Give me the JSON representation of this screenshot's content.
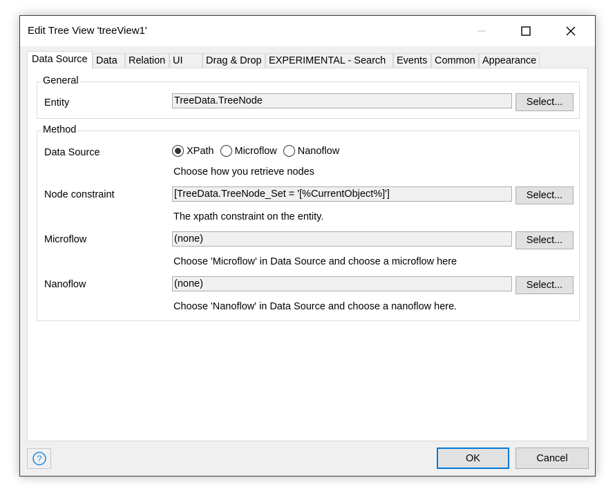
{
  "window": {
    "title": "Edit Tree View 'treeView1'"
  },
  "tabs": [
    {
      "label": "Data Source",
      "active": true
    },
    {
      "label": "Data",
      "active": false
    },
    {
      "label": "Relation",
      "active": false
    },
    {
      "label": "UI",
      "active": false
    },
    {
      "label": "Drag & Drop",
      "active": false
    },
    {
      "label": "EXPERIMENTAL - Search",
      "active": false
    },
    {
      "label": "Events",
      "active": false
    },
    {
      "label": "Common",
      "active": false
    },
    {
      "label": "Appearance",
      "active": false
    }
  ],
  "general": {
    "title": "General",
    "entity_label": "Entity",
    "entity_value": "TreeData.TreeNode",
    "select_label": "Select..."
  },
  "method": {
    "title": "Method",
    "data_source_label": "Data Source",
    "options": [
      "XPath",
      "Microflow",
      "Nanoflow"
    ],
    "selected_option": "XPath",
    "data_source_hint": "Choose how you retrieve nodes",
    "node_constraint_label": "Node constraint",
    "node_constraint_value": "[TreeData.TreeNode_Set = '[%CurrentObject%]']",
    "node_constraint_hint": "The xpath constraint on the entity.",
    "microflow_label": "Microflow",
    "microflow_value": "(none)",
    "microflow_hint": "Choose 'Microflow' in Data Source and choose a microflow here",
    "nanoflow_label": "Nanoflow",
    "nanoflow_value": "(none)",
    "nanoflow_hint": "Choose 'Nanoflow' in Data Source and choose a nanoflow here.",
    "select_label": "Select..."
  },
  "footer": {
    "help_icon": "question-circle-icon",
    "ok_label": "OK",
    "cancel_label": "Cancel"
  },
  "colors": {
    "accent": "#0078d7",
    "help_icon": "#2b8ee6"
  }
}
